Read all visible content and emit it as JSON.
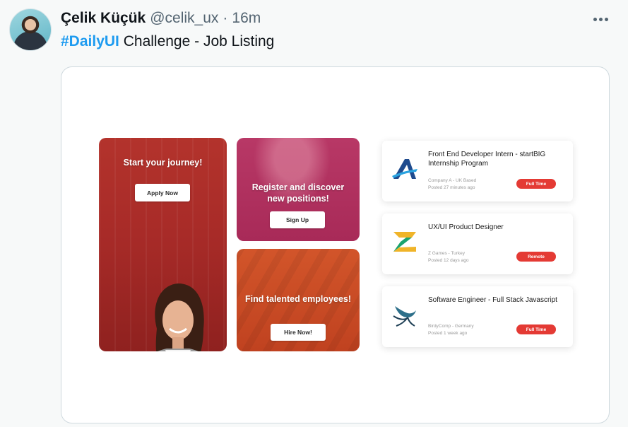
{
  "tweet": {
    "author_name": "Çelik Küçük",
    "author_handle": "@celik_ux",
    "separator": "·",
    "time": "16m",
    "hashtag": "#DailyUI",
    "text": "Challenge - Job Listing",
    "more_icon": "ellipsis-icon"
  },
  "promos": [
    {
      "title": "Start your journey!",
      "button": "Apply Now",
      "color": "#a82b28"
    },
    {
      "title": "Register and discover new positions!",
      "button": "Sign Up",
      "color": "#a82a58"
    },
    {
      "title": "Find talented employees!",
      "button": "Hire Now!",
      "color": "#c04220"
    }
  ],
  "jobs": [
    {
      "title": "Front End Developer Intern - startBIG Internship Program",
      "company": "Company A - UK Based",
      "posted": "Posted 27 minutes ago",
      "badge": "Full Time",
      "logo": "company-a-logo"
    },
    {
      "title": "UX/UI Product Designer",
      "company": "Z Games - Turkey",
      "posted": "Posted 12 days ago",
      "badge": "Remote",
      "logo": "z-games-logo"
    },
    {
      "title": "Software Engineer - Full Stack Javascript",
      "company": "BirdyComp - Germany",
      "posted": "Posted 1 week ago",
      "badge": "Full Time",
      "logo": "birdycomp-logo"
    }
  ],
  "colors": {
    "accent": "#1d9bf0",
    "badge": "#e43a34"
  }
}
